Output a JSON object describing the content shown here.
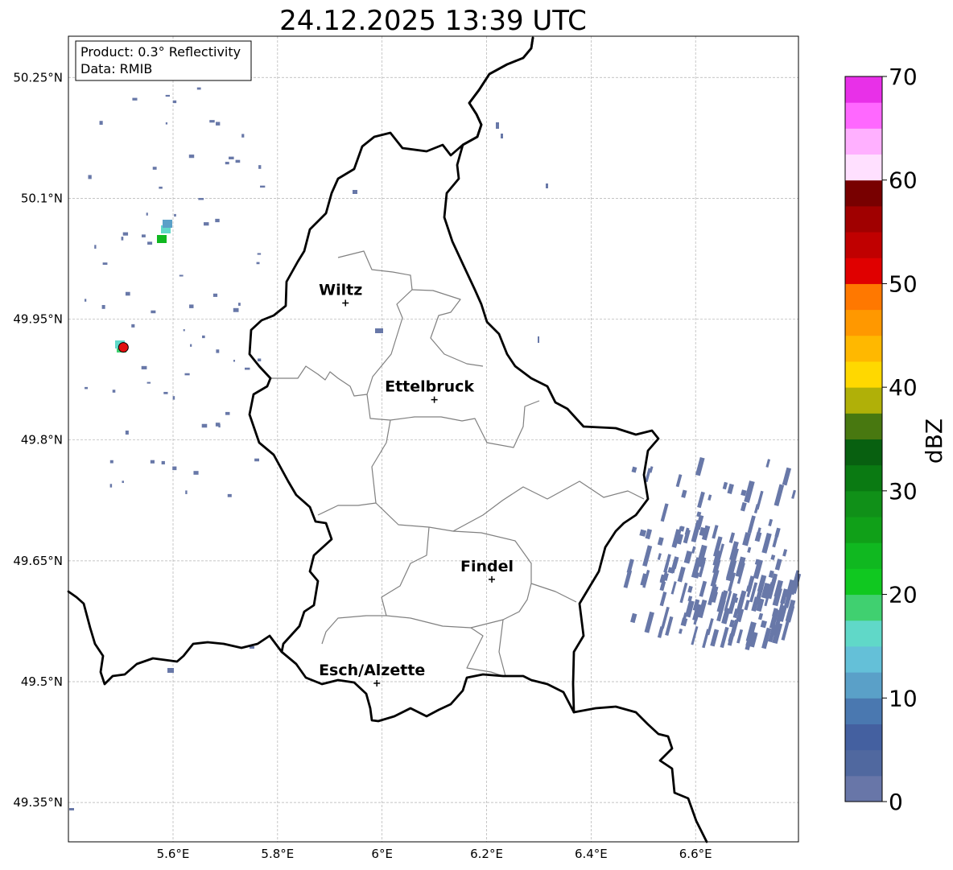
{
  "title": "24.12.2025 13:39 UTC",
  "info_box": {
    "product_line": "Product: 0.3° Reflectivity",
    "data_line": "Data: RMIB"
  },
  "map": {
    "lon_range": [
      5.4,
      6.8
    ],
    "lat_range": [
      49.3,
      50.3
    ],
    "x_ticks": [
      {
        "value": 5.6,
        "label": "5.6°E"
      },
      {
        "value": 5.8,
        "label": "5.8°E"
      },
      {
        "value": 6.0,
        "label": "6°E"
      },
      {
        "value": 6.2,
        "label": "6.2°E"
      },
      {
        "value": 6.4,
        "label": "6.4°E"
      },
      {
        "value": 6.6,
        "label": "6.6°E"
      }
    ],
    "y_ticks": [
      {
        "value": 50.25,
        "label": "50.25°N"
      },
      {
        "value": 50.1,
        "label": "50.1°N"
      },
      {
        "value": 49.95,
        "label": "49.95°N"
      },
      {
        "value": 49.8,
        "label": "49.8°N"
      },
      {
        "value": 49.65,
        "label": "49.65°N"
      },
      {
        "value": 49.5,
        "label": "49.5°N"
      },
      {
        "value": 49.35,
        "label": "49.35°N"
      }
    ],
    "grid": true,
    "cities": [
      {
        "name": "Wiltz",
        "lon": 5.93,
        "lat": 49.97
      },
      {
        "name": "Ettelbruck",
        "lon": 6.1,
        "lat": 49.85
      },
      {
        "name": "Findel",
        "lon": 6.21,
        "lat": 49.627
      },
      {
        "name": "Esch/Alzette",
        "lon": 5.99,
        "lat": 49.498
      }
    ],
    "radar_site": {
      "lon": 5.505,
      "lat": 49.915
    },
    "colors": {
      "country_border": "#000000",
      "canton_border": "#808080",
      "grid": "#b0b0b0",
      "radar_marker": "#e01010",
      "echo_main": "#6878a8"
    }
  },
  "colorbar": {
    "label": "dBZ",
    "min": 0,
    "max": 70,
    "step": 2.5,
    "ticks": [
      {
        "value": 0,
        "label": "0"
      },
      {
        "value": 10,
        "label": "10"
      },
      {
        "value": 20,
        "label": "20"
      },
      {
        "value": 30,
        "label": "30"
      },
      {
        "value": 40,
        "label": "40"
      },
      {
        "value": 50,
        "label": "50"
      },
      {
        "value": 60,
        "label": "60"
      },
      {
        "value": 70,
        "label": "70"
      }
    ],
    "colors": [
      "#6876a8",
      "#50689f",
      "#4460a0",
      "#4a78b0",
      "#5aa0c8",
      "#64c0d8",
      "#60d8c8",
      "#40d070",
      "#10c820",
      "#10b820",
      "#10a018",
      "#109018",
      "#0a7a12",
      "#086010",
      "#487810",
      "#b0b008",
      "#ffd800",
      "#ffb800",
      "#ff9800",
      "#ff7800",
      "#e00000",
      "#c00000",
      "#a00000",
      "#780000",
      "#ffe0ff",
      "#ffb0ff",
      "#ff68ff",
      "#e830e8"
    ]
  }
}
